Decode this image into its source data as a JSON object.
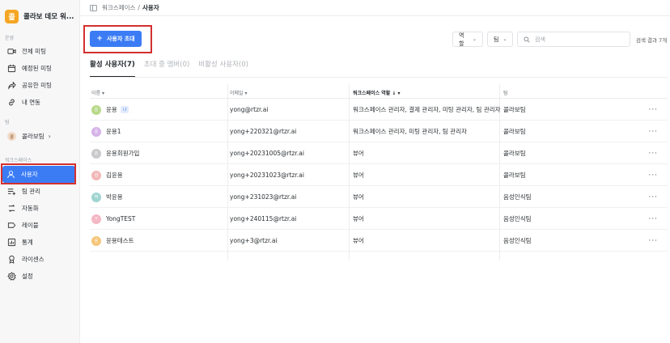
{
  "workspace": {
    "logo": "콜",
    "name": "콜라보 데모 워..."
  },
  "sidebar": {
    "section_meeting": "운영",
    "meeting_items": [
      {
        "label": "전체 미팅",
        "icon": "video-icon"
      },
      {
        "label": "예정된 미팅",
        "icon": "calendar-icon"
      },
      {
        "label": "공유한 미팅",
        "icon": "share-icon"
      },
      {
        "label": "내 연동",
        "icon": "link-icon"
      }
    ],
    "section_team": "팀",
    "team": {
      "avatar": "콜",
      "label": "콜라보팀",
      "chevron": "›"
    },
    "section_workspace": "워크스페이스",
    "workspace_items": [
      {
        "label": "사용자",
        "icon": "user-icon",
        "active": true
      },
      {
        "label": "팀 관리",
        "icon": "team-manage-icon"
      },
      {
        "label": "자동화",
        "icon": "automation-icon"
      },
      {
        "label": "레이블",
        "icon": "label-icon"
      },
      {
        "label": "통계",
        "icon": "stats-icon"
      },
      {
        "label": "라이센스",
        "icon": "license-icon"
      },
      {
        "label": "설정",
        "icon": "gear-icon"
      }
    ]
  },
  "breadcrumb": {
    "parent": "워크스페이스",
    "separator": "/",
    "current": "사용자"
  },
  "toolbar": {
    "invite_label": "사용자 초대",
    "role_filter": "역할",
    "team_filter": "팀",
    "search_placeholder": "검색",
    "result_count": "검색 결과 7개"
  },
  "tabs": [
    {
      "label": "활성 사용자(7)",
      "active": true
    },
    {
      "label": "초대 중 멤버(0)",
      "active": false
    },
    {
      "label": "비활성 사용자(0)",
      "active": false
    }
  ],
  "table": {
    "columns": {
      "name": "이름 ▾",
      "email": "이메일 ▾",
      "role": "워크스페이스 역할 ↓   ▾",
      "team": "팀"
    },
    "rows": [
      {
        "initial": "운",
        "name": "윤용",
        "badge": "나",
        "email": "yong@rtzr.ai",
        "role": "워크스페이스 관리자, 결제 관리자, 미팅 관리자, 팀 관리자",
        "team": "콜라보팀",
        "color": "#b9d98a"
      },
      {
        "initial": "윤",
        "name": "윤용1",
        "badge": "",
        "email": "yong+220321@rtzr.ai",
        "role": "워크스페이스 관리자, 미팅 관리자, 팀 관리자",
        "team": "콜라보팀",
        "color": "#d5b3e8"
      },
      {
        "initial": "윤",
        "name": "윤용회원가입",
        "badge": "",
        "email": "yong+20231005@rtzr.ai",
        "role": "뷰어",
        "team": "콜라보팀",
        "color": "#c9c9cc"
      },
      {
        "initial": "김",
        "name": "김윤용",
        "badge": "",
        "email": "yong+20231023@rtzr.ai",
        "role": "뷰어",
        "team": "콜라보팀",
        "color": "#f2b7b7"
      },
      {
        "initial": "박",
        "name": "박윤용",
        "badge": "",
        "email": "yong+231023@rtzr.ai",
        "role": "뷰어",
        "team": "음성인식팀",
        "color": "#9fd4d1"
      },
      {
        "initial": "Y",
        "name": "YongTEST",
        "badge": "",
        "email": "yong+240115@rtzr.ai",
        "role": "뷰어",
        "team": "음성인식팀",
        "color": "#f4b8c4"
      },
      {
        "initial": "윤",
        "name": "윤용테스트",
        "badge": "",
        "email": "yong+3@rtzr.ai",
        "role": "뷰어",
        "team": "음성인식팀",
        "color": "#f4c67a"
      }
    ],
    "more_label": "···"
  }
}
